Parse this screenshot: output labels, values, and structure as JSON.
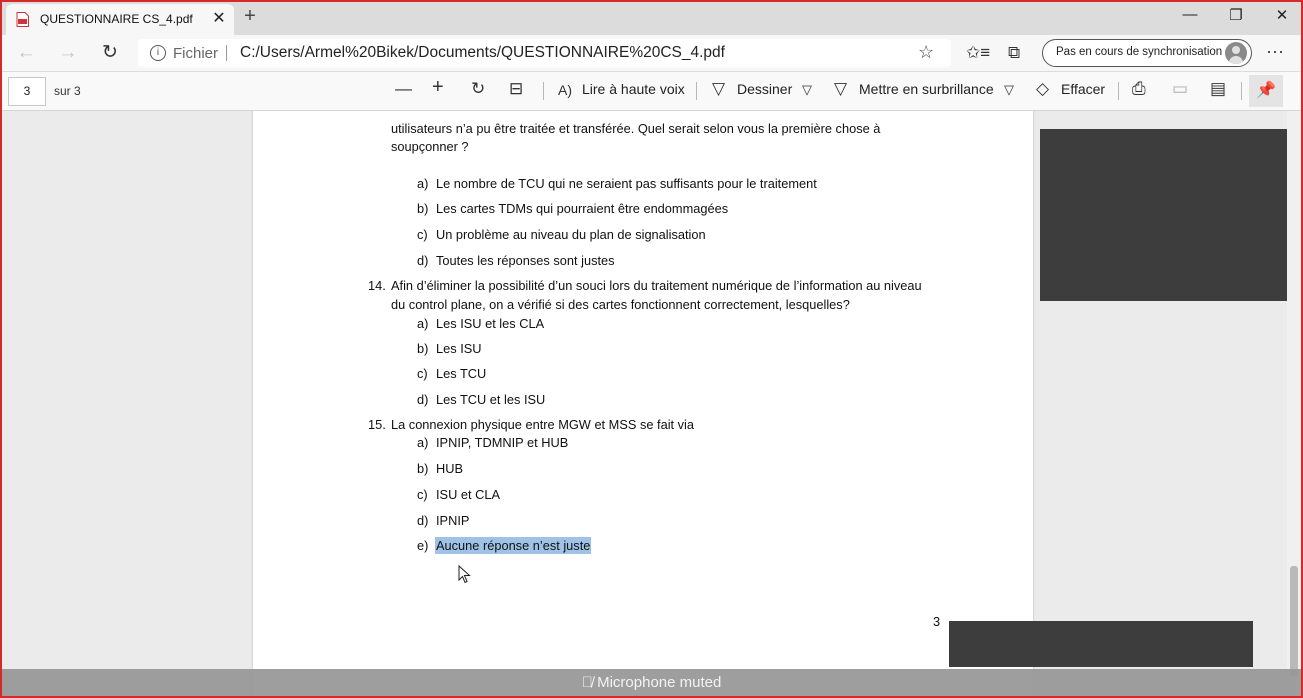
{
  "browser": {
    "tab_title": "QUESTIONNAIRE CS_4.pdf",
    "tab_close": "✕",
    "new_tab": "+",
    "window_buttons": [
      "—",
      "❐",
      "✕"
    ],
    "address": {
      "info_icon": "i",
      "scheme_label": "Fichier",
      "url": "C:/Users/Armel%20Bikek/Documents/QUESTIONNAIRE%20CS_4.pdf"
    },
    "sync_label": "Pas en cours de synchronisation",
    "more": "···"
  },
  "pdf_toolbar": {
    "page_current": "3",
    "page_total": "sur 3",
    "read_aloud": "Lire à haute voix",
    "draw": "Dessiner",
    "highlight": "Mettre en surbrillance",
    "erase": "Effacer"
  },
  "document": {
    "q13_lines": [
      "utilisateurs n’a pu être traitée et transférée. Quel serait selon vous la première chose à",
      "soupçonner ?"
    ],
    "q13_answers": [
      {
        "letter": "a)",
        "text": "Le nombre de TCU qui ne seraient pas suffisants pour le traitement"
      },
      {
        "letter": "b)",
        "text": "Les cartes TDMs qui pourraient être endommagées"
      },
      {
        "letter": "c)",
        "text": "Un problème au niveau du plan de signalisation"
      },
      {
        "letter": "d)",
        "text": "Toutes les réponses sont justes"
      }
    ],
    "q14_number": "14.",
    "q14_lines": [
      "Afin d’éliminer la possibilité d’un souci lors du traitement numérique de l’information au niveau",
      "du control plane, on a vérifié si des cartes fonctionnent correctement, lesquelles?"
    ],
    "q14_answers": [
      {
        "letter": "a)",
        "text": "Les ISU et les CLA"
      },
      {
        "letter": "b)",
        "text": "Les ISU"
      },
      {
        "letter": "c)",
        "text": "Les TCU"
      },
      {
        "letter": "d)",
        "text": "Les TCU et les ISU"
      }
    ],
    "q15_number": "15.",
    "q15_text": "La connexion physique entre MGW et MSS se fait via",
    "q15_answers": [
      {
        "letter": "a)",
        "text": "IPNIP, TDMNIP et HUB"
      },
      {
        "letter": "b)",
        "text": "HUB"
      },
      {
        "letter": "c)",
        "text": "ISU et CLA"
      },
      {
        "letter": "d)",
        "text": "IPNIP"
      },
      {
        "letter": "e)",
        "text": "Aucune réponse n’est juste"
      }
    ],
    "page_number": "3"
  },
  "overlay": {
    "mic_status": "Microphone muted"
  }
}
